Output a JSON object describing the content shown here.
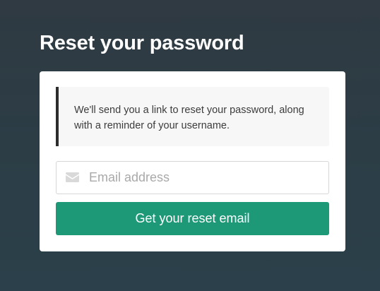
{
  "page": {
    "title": "Reset your password"
  },
  "notice": {
    "text": "We'll send you a link to reset your password, along with a reminder of your username."
  },
  "email": {
    "icon": "envelope-icon",
    "placeholder": "Email address",
    "value": ""
  },
  "submit": {
    "label": "Get your reset email"
  },
  "colors": {
    "background": "#2d3d45",
    "button": "#1e9978",
    "notice_border": "#2d2d2d",
    "notice_background": "#f7f7f7"
  }
}
